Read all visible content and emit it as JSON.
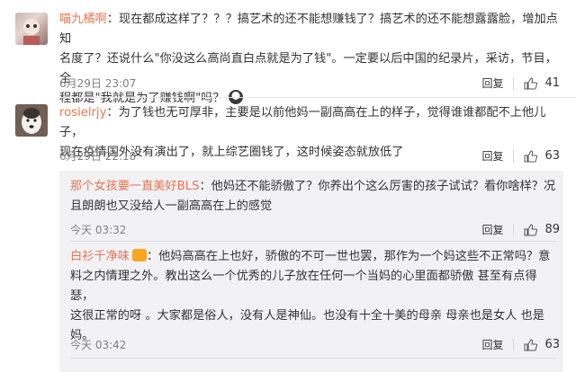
{
  "comments": [
    {
      "user": "喵九橘啊",
      "text_line1": "：现在都成这样了？？？搞艺术的还不能想赚钱了？搞艺术的还不能想露露脸，增加点知",
      "text_line2": "名度了？还说什么\"你没这么高尚直白点就是为了钱\"。一定要以后中国的纪录片，采访，节目，全",
      "text_line3": "程都是\"我就是为了赚钱啊\"吗？",
      "date": "6月29日 23:07",
      "reply_label": "回复",
      "likes": "41"
    },
    {
      "user": "rosielrjy",
      "text_line1": "：为了钱也无可厚非，主要是以前他妈一副高高在上的样子，觉得谁谁都配不上他儿子，",
      "text_line2": "现在疫情国外没有演出了，就上综艺圈钱了，这时候姿态就放低了",
      "date": "6月29日 22:18",
      "reply_label": "回复",
      "likes": "63"
    }
  ],
  "replies": [
    {
      "user": "那个女孩要一直美好BLS",
      "text_line1": "：他妈还不能骄傲了？你养出个这么厉害的孩子试试？看你啥样？况",
      "text_line2": "且朗朗也又没给人一副高高在上的感觉",
      "date": "今天 03:32",
      "reply_label": "回复",
      "likes": "89"
    },
    {
      "user": "白衫千净味",
      "text_line1": "：他妈高高在上也好，骄傲的不可一世也罢，那作为一个妈这些不正常吗？意",
      "text_line2": "料之内情理之外。教出这么一个优秀的儿子放在任何一个当妈的心里面都骄傲 甚至有点得瑟，",
      "text_line3": "这很正常的呀 。大家都是俗人，没有人是神仙。也没有十全十美的母亲 母亲也是女人 也是",
      "text_line4": "妈。",
      "date": "今天 03:42",
      "reply_label": "回复",
      "likes": "63"
    }
  ],
  "colors": {
    "username": "#eb7350",
    "meta": "#808080",
    "reply_bg": "#f2f2f5"
  }
}
